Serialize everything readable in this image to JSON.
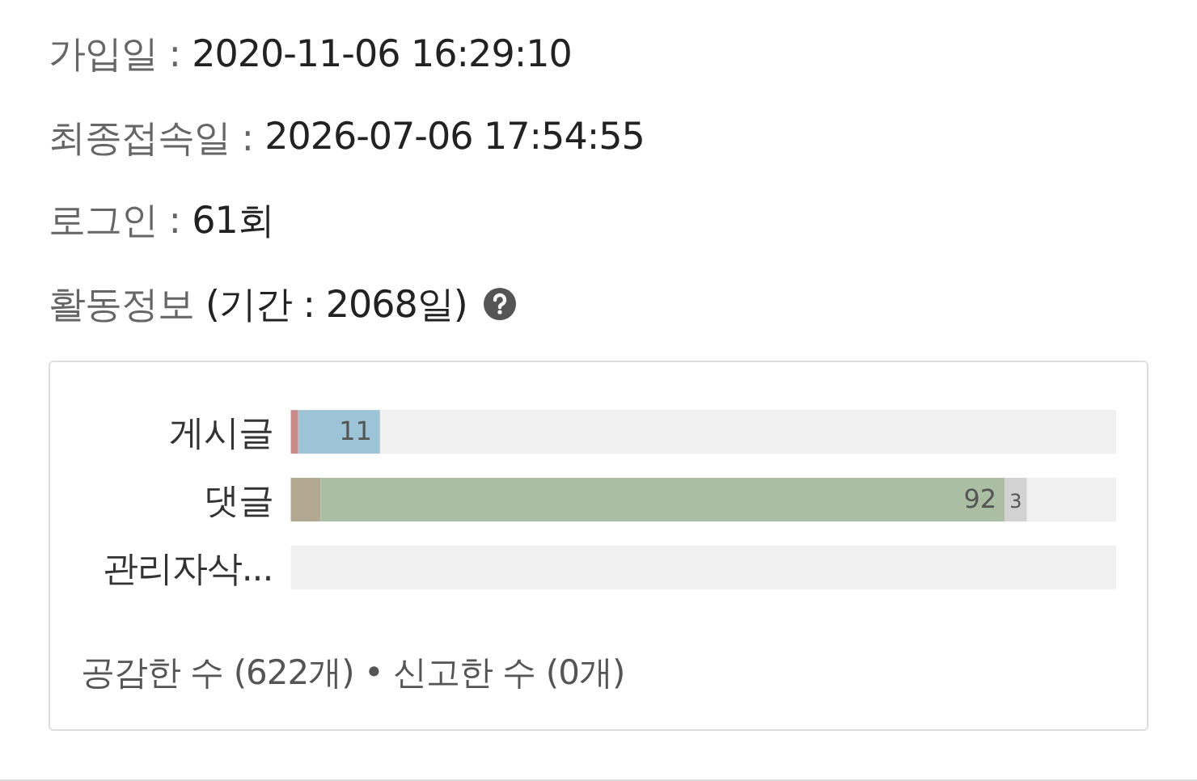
{
  "info": [
    {
      "label": "가입일 :",
      "value": "2020-11-06 16:29:10"
    },
    {
      "label": "최종접속일 :",
      "value": "2026-07-06 17:54:55"
    },
    {
      "label": "로그인 :",
      "value": "61회"
    }
  ],
  "activity": {
    "label": "활동정보",
    "period": "(기간 : 2068일)",
    "chart_data": {
      "type": "bar",
      "orientation": "horizontal",
      "stacked": true,
      "categories": [
        "게시글",
        "댓글",
        "관리자삭..."
      ],
      "xlim": [
        0,
        111
      ],
      "series": [
        {
          "color": "#c98a8a",
          "values": [
            1,
            null,
            null
          ],
          "data_labels": false
        },
        {
          "color": "#9dc3d6",
          "values": [
            11,
            null,
            null
          ],
          "data_labels": true
        },
        {
          "color": "#b3a891",
          "values": [
            null,
            4,
            null
          ],
          "data_labels": false
        },
        {
          "color": "#a9bea3",
          "values": [
            null,
            92,
            null
          ],
          "data_labels": true
        },
        {
          "color": "#d2d2d2",
          "values": [
            null,
            3,
            null
          ],
          "data_labels": true
        },
        {
          "color": "#f0f0f0",
          "values": [
            99,
            12,
            111
          ],
          "data_labels": false
        }
      ]
    },
    "summary": "공감한 수 (622개) • 신고한 수 (0개)"
  }
}
